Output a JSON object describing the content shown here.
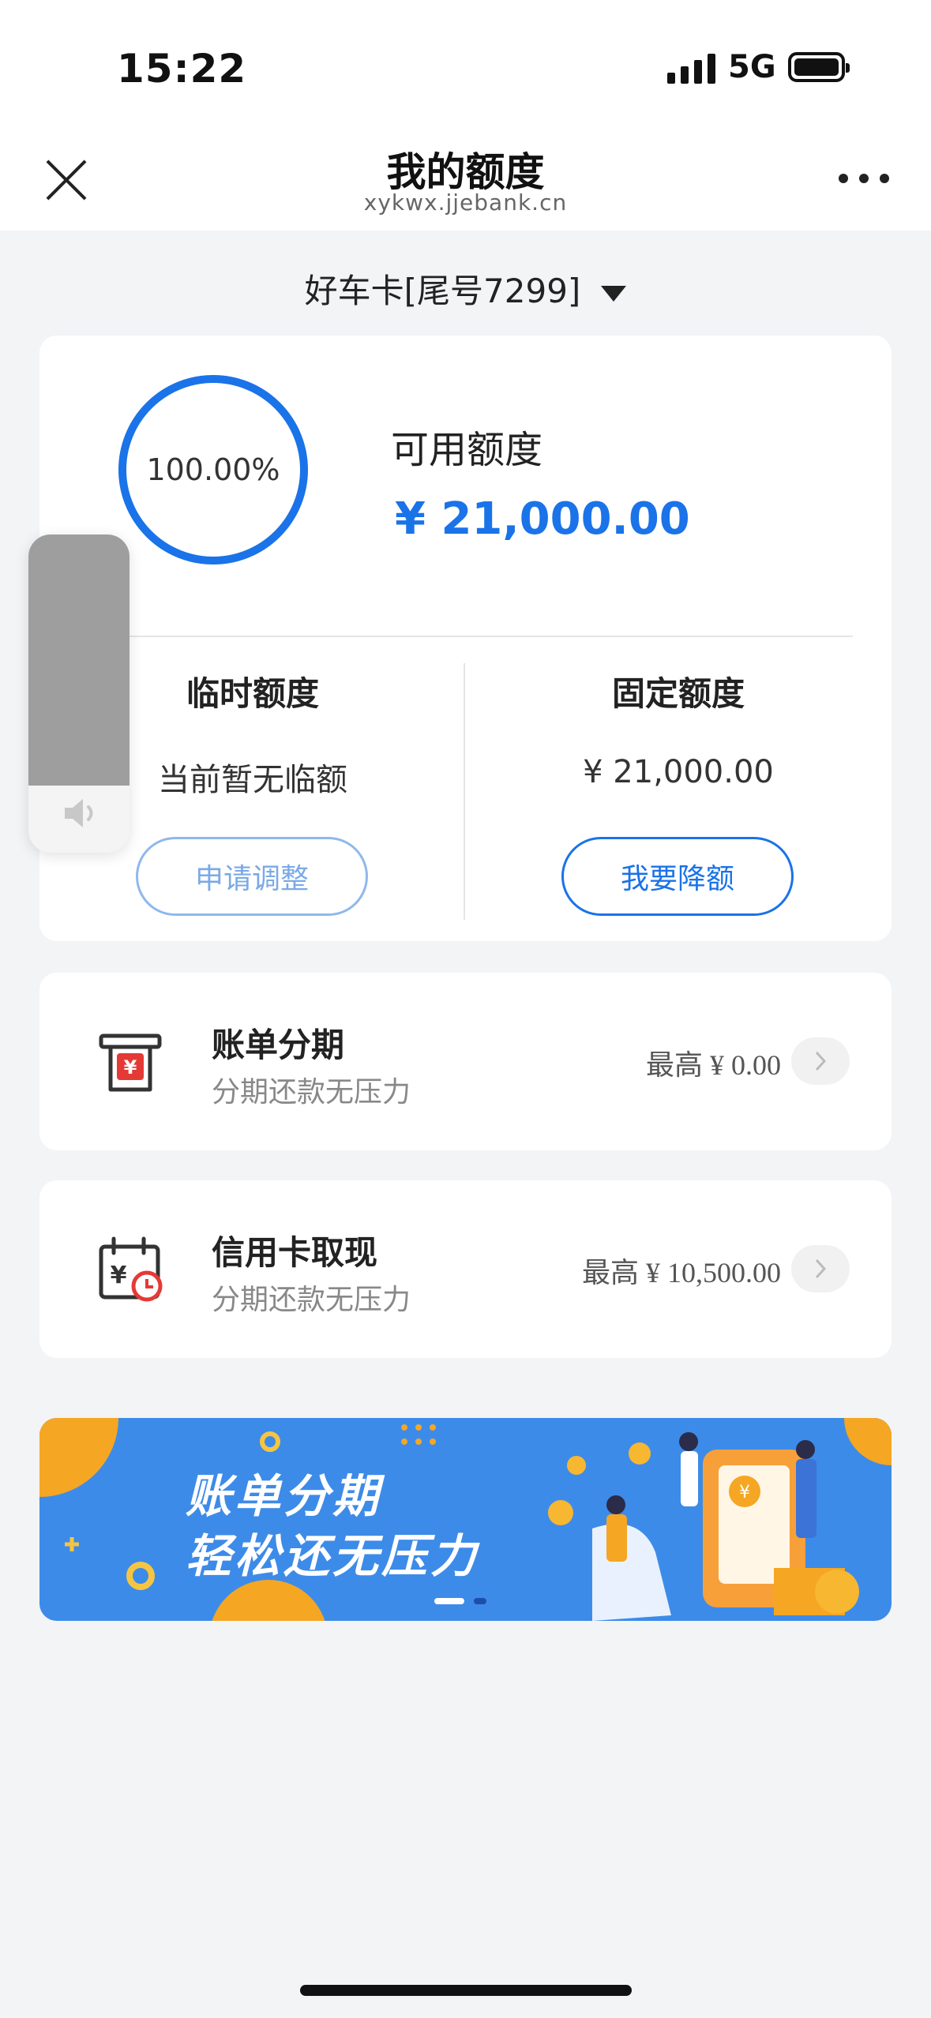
{
  "status": {
    "time": "15:22",
    "network": "5G"
  },
  "nav": {
    "title": "我的额度",
    "url": "xykwx.jjebank.cn"
  },
  "card_selector": {
    "label": "好车卡[尾号7299]"
  },
  "quota": {
    "ring_percent": "100.00%",
    "ring_fraction": 1.0,
    "available_label": "可用额度",
    "available_amount": "¥ 21,000.00",
    "temp_title": "临时额度",
    "temp_text": "当前暂无临额",
    "temp_button": "申请调整",
    "fixed_title": "固定额度",
    "fixed_text": "¥ 21,000.00",
    "fixed_button": "我要降额"
  },
  "volume": {
    "level": 0.79
  },
  "services": [
    {
      "title": "账单分期",
      "subtitle": "分期还款无压力",
      "max": "最高 ¥ 0.00",
      "icon": "bill-installment-icon"
    },
    {
      "title": "信用卡取现",
      "subtitle": "分期还款无压力",
      "max": "最高 ¥ 10,500.00",
      "icon": "cash-withdrawal-icon"
    }
  ],
  "banner": {
    "line1": "账单分期",
    "line2": "轻松还无压力"
  },
  "colors": {
    "accent": "#1a73e8",
    "red": "#e53935",
    "banner_bg": "#3d8be8",
    "banner_orange": "#f5a623"
  }
}
